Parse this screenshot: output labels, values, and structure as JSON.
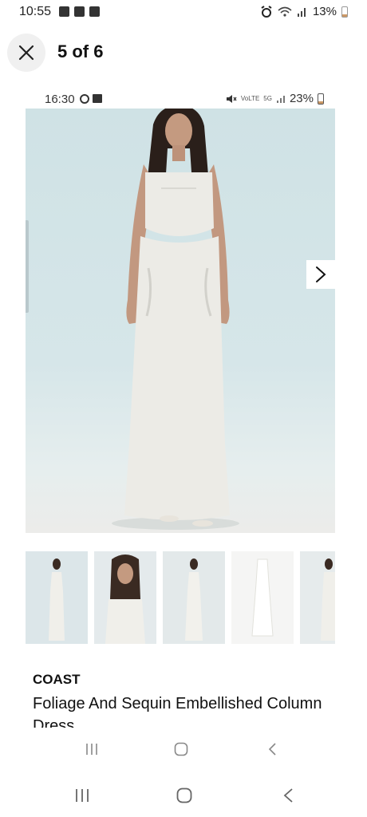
{
  "status_bar": {
    "time": "10:55",
    "battery": "13%"
  },
  "header": {
    "counter": "5 of 6"
  },
  "inner_status_bar": {
    "time": "16:30",
    "battery": "23%"
  },
  "product": {
    "brand": "COAST",
    "title": "Foliage And Sequin Embellished Column Dress"
  },
  "thumbnails": [
    "front-full",
    "front-closeup",
    "back-view",
    "flat-lay",
    "side-view"
  ],
  "icons": {
    "close": "close-icon",
    "next": "chevron-right-icon",
    "recents": "recents-icon",
    "home": "home-icon",
    "back": "back-icon"
  },
  "colors": {
    "image_bg": "#cfe2e5",
    "dress": "#ecebe6"
  }
}
